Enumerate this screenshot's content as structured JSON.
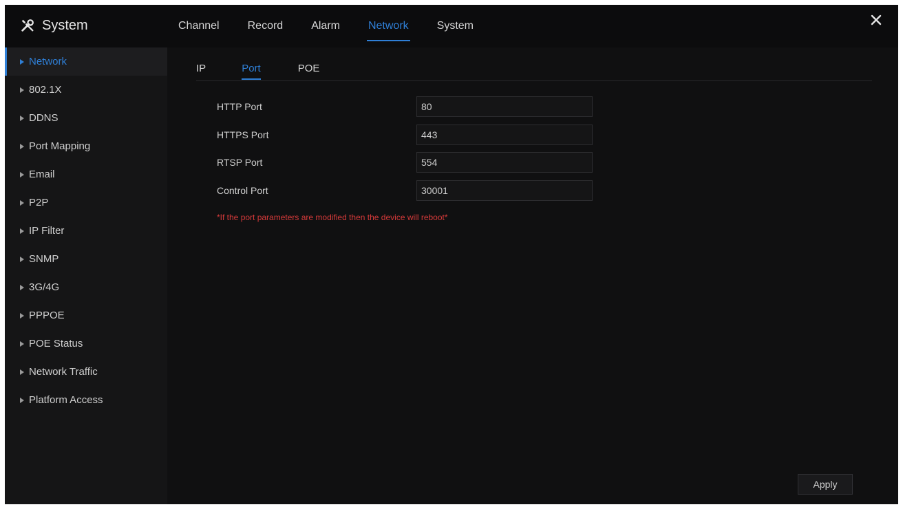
{
  "app": {
    "title": "System",
    "icon": "wrench-screwdriver-icon"
  },
  "top_tabs": [
    {
      "label": "Channel",
      "active": false
    },
    {
      "label": "Record",
      "active": false
    },
    {
      "label": "Alarm",
      "active": false
    },
    {
      "label": "Network",
      "active": true
    },
    {
      "label": "System",
      "active": false
    }
  ],
  "sidebar": {
    "items": [
      {
        "label": "Network",
        "active": true
      },
      {
        "label": "802.1X",
        "active": false
      },
      {
        "label": "DDNS",
        "active": false
      },
      {
        "label": "Port Mapping",
        "active": false
      },
      {
        "label": "Email",
        "active": false
      },
      {
        "label": "P2P",
        "active": false
      },
      {
        "label": "IP Filter",
        "active": false
      },
      {
        "label": "SNMP",
        "active": false
      },
      {
        "label": "3G/4G",
        "active": false
      },
      {
        "label": "PPPOE",
        "active": false
      },
      {
        "label": "POE Status",
        "active": false
      },
      {
        "label": "Network Traffic",
        "active": false
      },
      {
        "label": "Platform Access",
        "active": false
      }
    ]
  },
  "sub_tabs": [
    {
      "label": "IP",
      "active": false
    },
    {
      "label": "Port",
      "active": true
    },
    {
      "label": "POE",
      "active": false
    }
  ],
  "form": {
    "http": {
      "label": "HTTP Port",
      "value": "80"
    },
    "https": {
      "label": "HTTPS Port",
      "value": "443"
    },
    "rtsp": {
      "label": "RTSP Port",
      "value": "554"
    },
    "control": {
      "label": "Control Port",
      "value": "30001"
    }
  },
  "warning": "*If the port parameters are modified then the device will reboot*",
  "apply_label": "Apply",
  "colors": {
    "accent": "#2f7fd6",
    "warning": "#d63a3a",
    "background": "#101011"
  }
}
